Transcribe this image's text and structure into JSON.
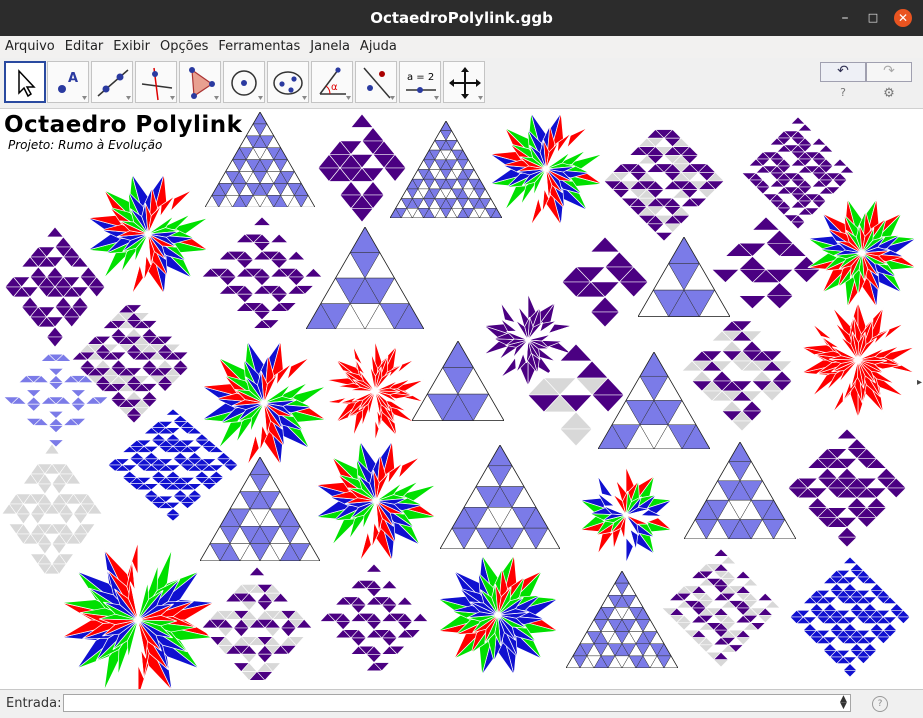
{
  "window": {
    "title": "OctaedroPolylink.ggb"
  },
  "menu": [
    "Arquivo",
    "Editar",
    "Exibir",
    "Opções",
    "Ferramentas",
    "Janela",
    "Ajuda"
  ],
  "toolbar": {
    "tools": [
      "move-tool",
      "point-tool",
      "line-tool",
      "perpendicular-line-tool",
      "polygon-tool",
      "circle-tool",
      "conic-tool",
      "angle-tool",
      "reflect-tool",
      "slider-tool",
      "move-view-tool"
    ],
    "slider_label": "a = 2",
    "undo_symbol": "↶",
    "redo_symbol": "↷"
  },
  "canvas": {
    "title": "Octaedro Polylink",
    "subtitle": "Projeto: Rumo à Evolução"
  },
  "input_bar": {
    "label": "Entrada:",
    "value": "",
    "placeholder": ""
  },
  "colors": {
    "purple": "#4b0082",
    "blue": "#7b7be8",
    "red": "#ff0000",
    "green": "#00e000",
    "royal": "#1010d0",
    "grey": "#d8d8d8",
    "titlebar": "#2c2c2c",
    "close": "#e95420"
  }
}
